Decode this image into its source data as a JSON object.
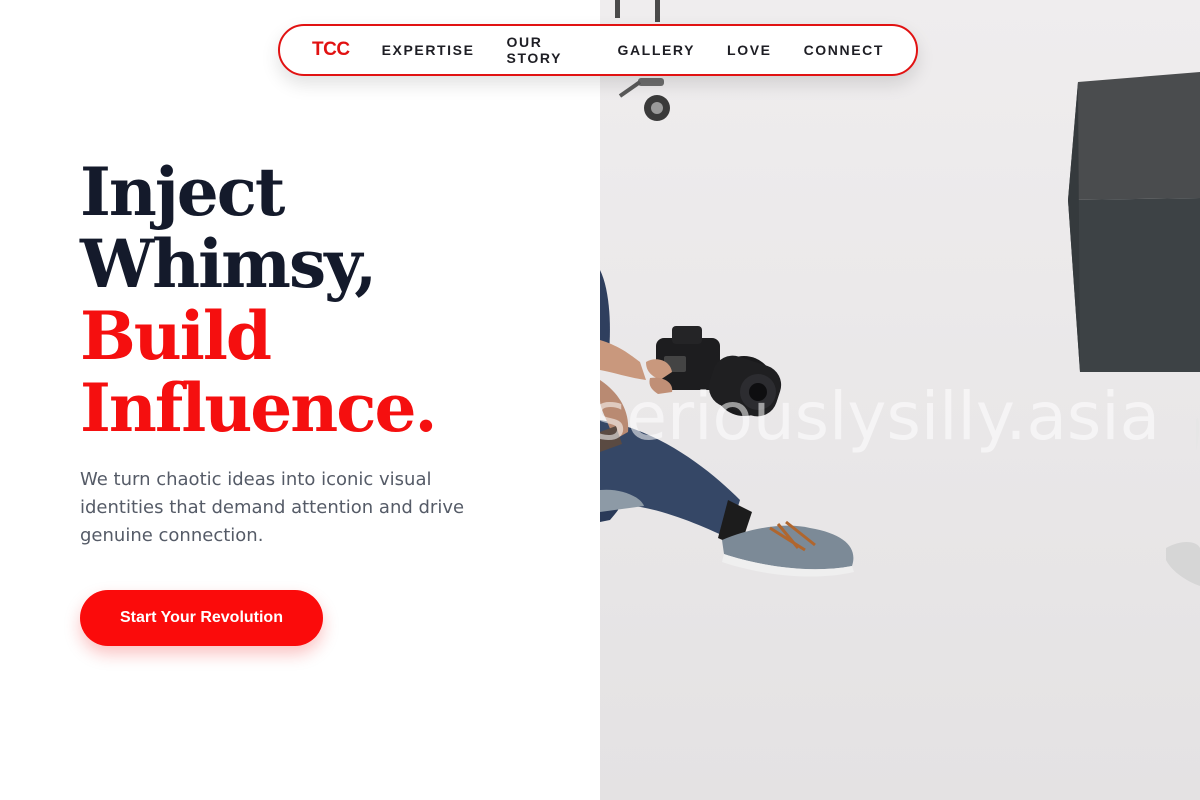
{
  "nav": {
    "logo": "TCC",
    "links": [
      "EXPERTISE",
      "OUR STORY",
      "GALLERY",
      "LOVE",
      "CONNECT"
    ]
  },
  "hero": {
    "headline_lines": [
      "Inject",
      "Whimsy,",
      "Build",
      "Influence."
    ],
    "subtitle": "We turn chaotic ideas into iconic visual identities that demand attention and drive genuine connection.",
    "cta_label": "Start Your Revolution"
  },
  "image": {
    "watermark": "seriouslysilly.asia"
  },
  "colors": {
    "accent": "#f50f0f",
    "heading_dark": "#141a2b",
    "body_text": "#555b67"
  }
}
